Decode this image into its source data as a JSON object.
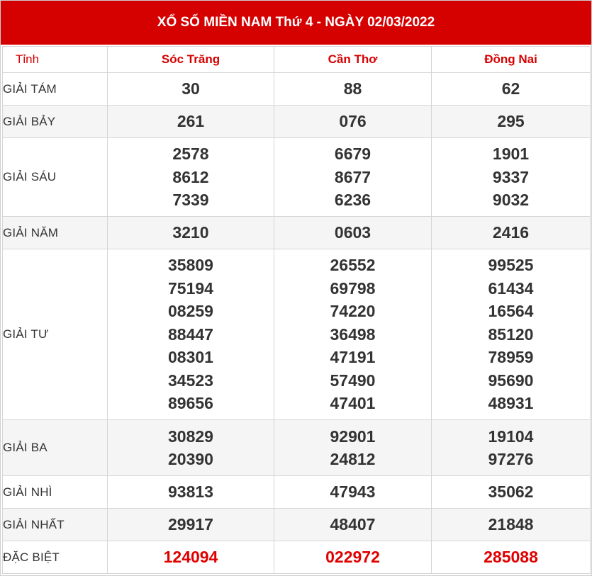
{
  "title": "XỔ SỐ MIỀN NAM Thứ 4 - NGÀY 02/03/2022",
  "header_label": "Tỉnh",
  "provinces": [
    "Sóc Trăng",
    "Cần Thơ",
    "Đồng Nai"
  ],
  "colors": {
    "accent": "#d50000",
    "special": "#e00000",
    "text": "#333333"
  },
  "prizes": [
    {
      "label": "GIẢI TÁM",
      "values": [
        [
          "30"
        ],
        [
          "88"
        ],
        [
          "62"
        ]
      ]
    },
    {
      "label": "GIẢI BẢY",
      "values": [
        [
          "261"
        ],
        [
          "076"
        ],
        [
          "295"
        ]
      ]
    },
    {
      "label": "GIẢI SÁU",
      "values": [
        [
          "2578",
          "8612",
          "7339"
        ],
        [
          "6679",
          "8677",
          "6236"
        ],
        [
          "1901",
          "9337",
          "9032"
        ]
      ]
    },
    {
      "label": "GIẢI NĂM",
      "values": [
        [
          "3210"
        ],
        [
          "0603"
        ],
        [
          "2416"
        ]
      ]
    },
    {
      "label": "GIẢI TƯ",
      "values": [
        [
          "35809",
          "75194",
          "08259",
          "88447",
          "08301",
          "34523",
          "89656"
        ],
        [
          "26552",
          "69798",
          "74220",
          "36498",
          "47191",
          "57490",
          "47401"
        ],
        [
          "99525",
          "61434",
          "16564",
          "85120",
          "78959",
          "95690",
          "48931"
        ]
      ]
    },
    {
      "label": "GIẢI BA",
      "values": [
        [
          "30829",
          "20390"
        ],
        [
          "92901",
          "24812"
        ],
        [
          "19104",
          "97276"
        ]
      ]
    },
    {
      "label": "GIẢI NHÌ",
      "values": [
        [
          "93813"
        ],
        [
          "47943"
        ],
        [
          "35062"
        ]
      ]
    },
    {
      "label": "GIẢI NHẤT",
      "values": [
        [
          "29917"
        ],
        [
          "48407"
        ],
        [
          "21848"
        ]
      ]
    },
    {
      "label": "ĐẶC BIỆT",
      "values": [
        [
          "124094"
        ],
        [
          "022972"
        ],
        [
          "285088"
        ]
      ]
    }
  ]
}
